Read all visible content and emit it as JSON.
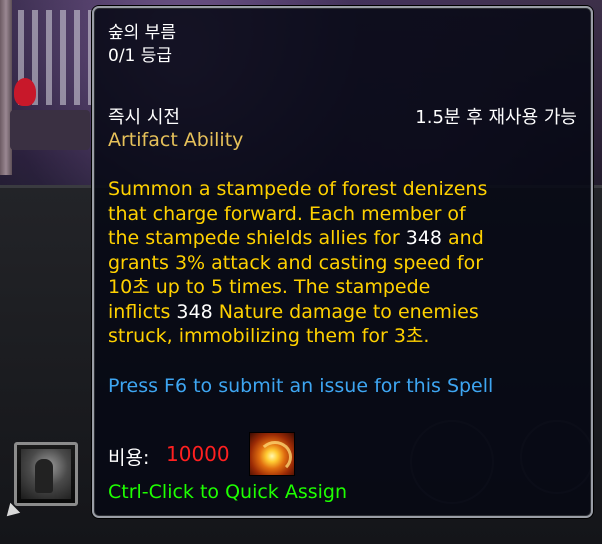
{
  "tooltip": {
    "ability_name": "숲의 부름",
    "rank": "0/1 등급",
    "cast_time": "즉시 시전",
    "cooldown": "1.5분 후 재사용 가능",
    "ability_type": "Artifact Ability",
    "description": {
      "line1": "Summon a stampede of forest denizens",
      "line2": "that charge forward. Each member of",
      "line3a": "the stampede shields allies for ",
      "line3_num": "348",
      "line3b": " and",
      "line4": "grants 3% attack and casting speed for",
      "line5": "10초 up to 5 times. The stampede",
      "line6a": "inflicts ",
      "line6_num": "348",
      "line6b": " Nature damage to enemies",
      "line7": "struck, immobilizing them for 3초."
    },
    "report_hint": "Press F6 to submit an issue for this Spell",
    "cost_label": "비용:",
    "cost_value": "10000",
    "spell_icon": "fire-vortex-icon",
    "quick_assign": "Ctrl-Click to Quick Assign"
  },
  "action_bar": {
    "slot_icon": "druid-ability-icon"
  },
  "colors": {
    "tooltip_bg": "#06081a",
    "border": "#9a9ea6",
    "white": "#ffffff",
    "gold": "#e6c15a",
    "yellow": "#ffd100",
    "blue": "#3ea6f2",
    "green": "#1eff00",
    "red": "#ff2020"
  }
}
